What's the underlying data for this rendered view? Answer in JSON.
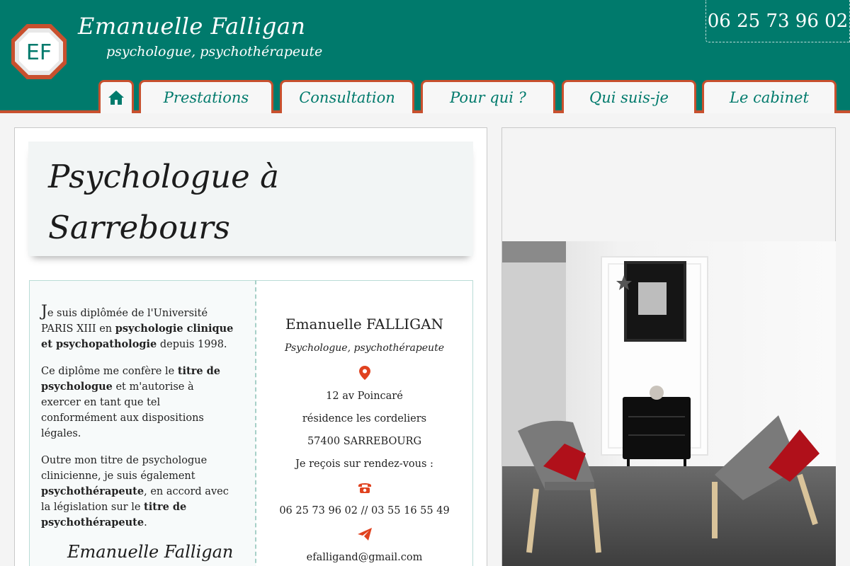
{
  "header": {
    "logo_text": "EF",
    "name": "Emanuelle Falligan",
    "tagline": "psychologue, psychothérapeute",
    "phone": "06 25 73 96 02"
  },
  "nav": {
    "home_icon": "home-icon",
    "items": [
      "Prestations",
      "Consultation",
      "Pour qui ?",
      "Qui suis-je",
      "Le cabinet"
    ]
  },
  "main": {
    "title_line1": "Psychologue à",
    "title_line2": "Sarrebours",
    "intro": {
      "p1_dropcap": "J",
      "p1_a": "e suis diplômée de l'Université PARIS XIII en ",
      "p1_bold": "psychologie clinique et psychopathologie",
      "p1_b": " depuis 1998.",
      "p2_a": "Ce diplôme me confère le ",
      "p2_bold": "titre de psychologue",
      "p2_b": " et m'autorise à exercer en tant que tel conformément aux dispositions légales.",
      "p3_a": "Outre mon titre de psychologue clinicienne, je suis également ",
      "p3_bold1": "psychothérapeute",
      "p3_b": ", en accord avec la législation sur le ",
      "p3_bold2": "titre de psychothérapeute",
      "p3_c": "."
    },
    "signature": "Emanuelle Falligan",
    "contact": {
      "name": "Emanuelle FALLIGAN",
      "role": "Psychologue, psychothérapeute",
      "address_icon": "map-pin-icon",
      "address1": "12 av Poincaré",
      "address2": "résidence les cordeliers",
      "address3": "57400 SARREBOURG",
      "appointment": "Je reçois sur rendez-vous :",
      "phone_icon": "phone-icon",
      "phones": "06 25 73 96 02 // 03 55 16 55 49",
      "email_icon": "paper-plane-icon",
      "email": "efalligand@gmail.com"
    }
  },
  "colors": {
    "brand_teal": "#007a6c",
    "accent_orange": "#c8502e",
    "icon_red": "#e0421f"
  }
}
